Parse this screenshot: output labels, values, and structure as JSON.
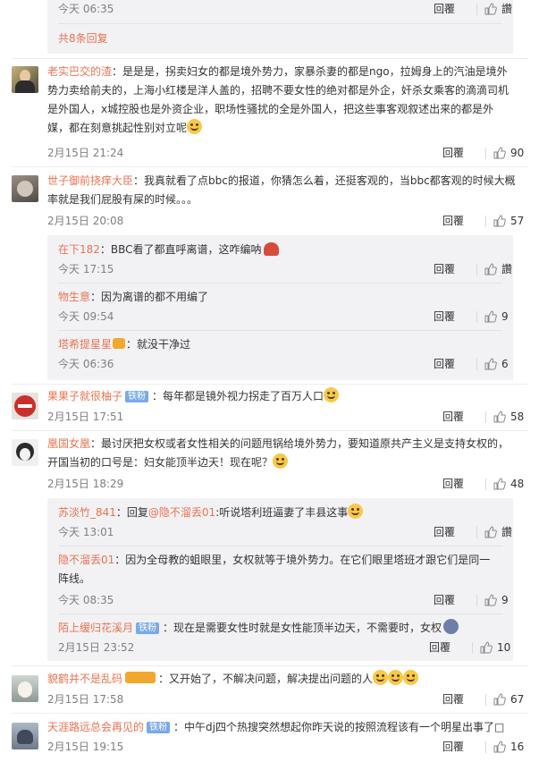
{
  "reply_label": "回覆",
  "c0": {
    "time": "今天 06:35",
    "likes": "讚",
    "more_replies": "共8条回复"
  },
  "c1": {
    "name": "老实巴交的渣",
    "text_l1": "：是是是，拐卖妇女的都是境外势力，家暴杀妻的都是ngo，拉姆身上的汽油是境外",
    "text_l2": "势力卖给前夫的，上海小红楼是洋人盖的，招聘不要女性的绝对都是外企，奸杀女乘客的滴滴司机",
    "text_l3": "是外国人，x城控股也是外资企业，职场性骚扰的全是外国人，把这些事客观叙述出来的都是外",
    "text_l4": "媒，都在刻意挑起性别对立呢",
    "time": "2月15日 21:24",
    "likes": "90"
  },
  "c2": {
    "name": "世子御前挠痒大臣",
    "text_l1": "：我真就看了点bbc的报道，你猜怎么着，还挺客观的，当bbc都客观的时候大概",
    "text_l2": "率就是我们屁股有屎的时候。。。",
    "time": "2月15日 20:08",
    "likes": "57",
    "replies": [
      {
        "name": "在下182",
        "text": "：BBC看了都直呼离谱，这咋编呐",
        "time": "今天 17:15",
        "likes": "讚"
      },
      {
        "name": "物生意",
        "text": "：因为离谱的都不用编了",
        "time": "今天 09:54",
        "likes": "9"
      },
      {
        "name": "塔希提星星",
        "text": "：就没干净过",
        "time": "今天 06:36",
        "likes": "6"
      }
    ]
  },
  "c3": {
    "name": "果果子就很柚子",
    "badge": "铁粉",
    "text": "：每年都是镜外视力拐走了百万人口",
    "time": "2月15日 17:51",
    "likes": "58"
  },
  "c4": {
    "name": "凰国女凰",
    "text_l1": "：最讨厌把女权或者女性相关的问题甩锅给境外势力，要知道原共产主义是支持女权的，",
    "text_l2": "开国当初的口号是：妇女能顶半边天！现在呢？",
    "time": "2月15日 18:29",
    "likes": "48",
    "replies": [
      {
        "name": "苏淡竹_841",
        "text_pre": "：回复",
        "mention": "@隐不溜丢01",
        "text": ":听说塔利班逼妻了丰县这事",
        "time": "今天 13:01",
        "likes": "讚"
      },
      {
        "name": "隐不溜丢01",
        "text_l1": "：因为全母教的蛆眼里，女权就等于境外势力。在它们眼里塔班才跟它们是同一",
        "text_l2": "阵线。",
        "time": "今天 08:35",
        "likes": "9"
      },
      {
        "name": "陌上缓归花溪月",
        "badge": "铁粉",
        "text": "：现在是需要女性时就是女性能顶半边天，不需要时，女权",
        "time": "2月15日 23:52",
        "likes": "10"
      }
    ]
  },
  "c5": {
    "name": "貌鹤并不是乱码",
    "text": "：又开始了，不解决问题，解决提出问题的人",
    "time": "2月15日 17:58",
    "likes": "67"
  },
  "c6": {
    "name": "天涯路远总会再见的",
    "badge": "铁粉",
    "text": "：中午dj四个热搜突然想起你昨天说的按照流程该有一个明星出事了□",
    "time": "2月15日 19:15",
    "likes": "16"
  },
  "colors": {
    "name": "#eb7350",
    "time": "#808080",
    "sub_bg": "#f2f2f5",
    "badge": "#7aa9ea"
  }
}
